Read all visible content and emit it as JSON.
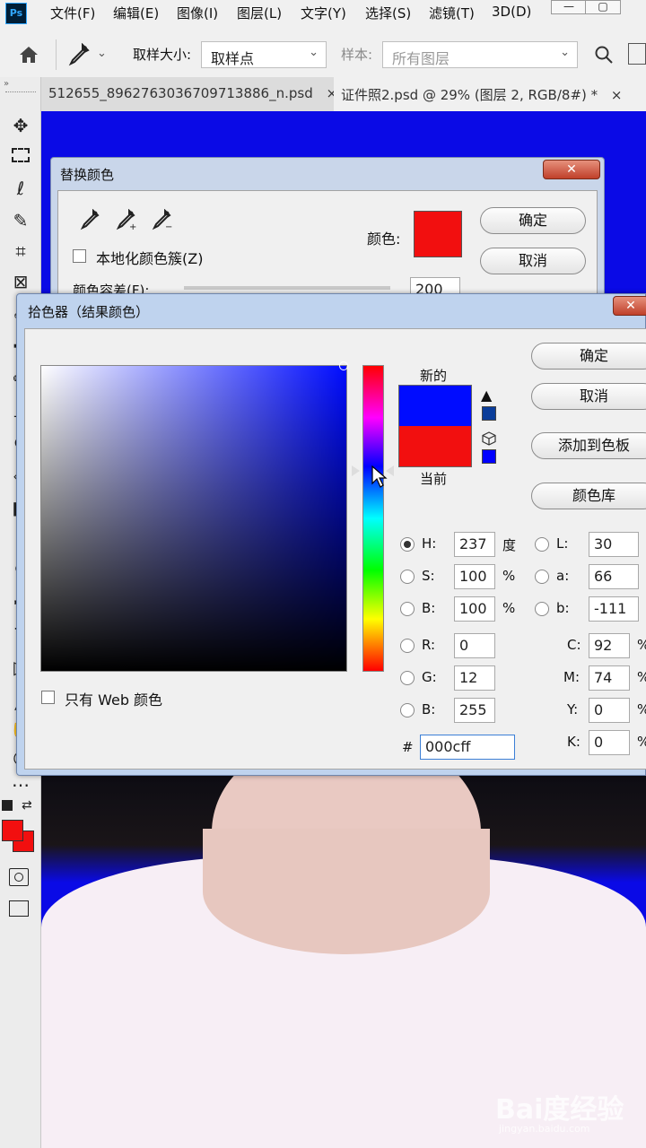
{
  "menubar": {
    "logo": "Ps",
    "items": [
      "文件(F)",
      "编辑(E)",
      "图像(I)",
      "图层(L)",
      "文字(Y)",
      "选择(S)",
      "滤镜(T)",
      "3D(D)"
    ],
    "window_buttons": [
      "—",
      "▢"
    ]
  },
  "options": {
    "sample_size_label": "取样大小:",
    "sample_size_value": "取样点",
    "sample_label": "样本:",
    "sample_value": "所有图层"
  },
  "tabs": [
    {
      "label": "512655_8962763036709713886_n.psd",
      "close": "×"
    },
    {
      "label": "证件照2.psd @ 29% (图层 2, RGB/8#) *",
      "close": "×"
    }
  ],
  "replace_color": {
    "title": "替换颜色",
    "close": "✕",
    "localized_label": "本地化颜色簇(Z)",
    "color_label": "颜色:",
    "color_value": "#f20f0f",
    "tolerance_label": "颜色容差(F):",
    "tolerance_value": "200",
    "ok": "确定",
    "cancel": "取消"
  },
  "color_picker": {
    "title": "拾色器（结果颜色）",
    "close": "✕",
    "new_label": "新的",
    "current_label": "当前",
    "new_color": "#000cff",
    "current_color": "#f20f0f",
    "ok": "确定",
    "cancel": "取消",
    "add_swatch": "添加到色板",
    "libraries": "颜色库",
    "web_only": "只有 Web 颜色",
    "hsb": [
      {
        "label": "H:",
        "value": "237",
        "unit": "度",
        "checked": true
      },
      {
        "label": "S:",
        "value": "100",
        "unit": "%",
        "checked": false
      },
      {
        "label": "B:",
        "value": "100",
        "unit": "%",
        "checked": false
      }
    ],
    "rgb": [
      {
        "label": "R:",
        "value": "0"
      },
      {
        "label": "G:",
        "value": "12"
      },
      {
        "label": "B:",
        "value": "255"
      }
    ],
    "lab": [
      {
        "label": "L:",
        "value": "30"
      },
      {
        "label": "a:",
        "value": "66"
      },
      {
        "label": "b:",
        "value": "-111"
      }
    ],
    "cmyk": [
      {
        "label": "C:",
        "value": "92",
        "unit": "%"
      },
      {
        "label": "M:",
        "value": "74",
        "unit": "%"
      },
      {
        "label": "Y:",
        "value": "0",
        "unit": "%"
      },
      {
        "label": "K:",
        "value": "0",
        "unit": "%"
      }
    ],
    "hex_label": "#",
    "hex_value": "000cff"
  },
  "watermark": {
    "main": "Bai度经验",
    "sub": "jingyan.baidu.com"
  }
}
